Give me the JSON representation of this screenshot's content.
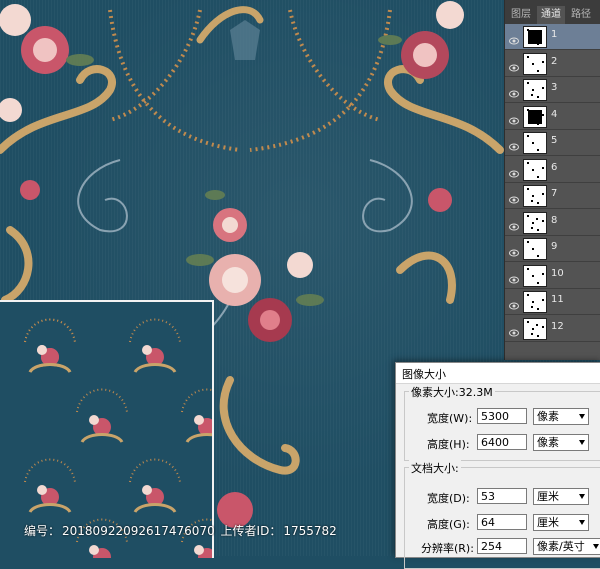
{
  "panel": {
    "tabs": [
      "图层",
      "通道",
      "路径"
    ],
    "active_tab": "通道",
    "channels": [
      "1",
      "2",
      "3",
      "4",
      "5",
      "6",
      "7",
      "8",
      "9",
      "10",
      "11",
      "12"
    ],
    "selected_channel": "1"
  },
  "dialog": {
    "title": "图像大小",
    "pixel_size_label": "像素大小:32.3M",
    "width_label": "宽度(W):",
    "width_value": "5300",
    "width_unit": "像素",
    "height_label": "高度(H):",
    "height_value": "6400",
    "height_unit": "像素",
    "doc_size_label": "文档大小:",
    "doc_width_label": "宽度(D):",
    "doc_width_value": "53",
    "doc_width_unit": "厘米",
    "doc_height_label": "高度(G):",
    "doc_height_value": "64",
    "doc_height_unit": "厘米",
    "resolution_label": "分辨率(R):",
    "resolution_value": "254",
    "resolution_unit": "像素/英寸"
  },
  "watermark": {
    "id_label": "编号：",
    "id_value": "20180922092617476070",
    "uploader_label": "上传者ID：",
    "uploader_value": "1755782"
  },
  "colors": {
    "background": "#1f4e63",
    "ornament": "#c9a46a",
    "flower": "#c9566a"
  }
}
